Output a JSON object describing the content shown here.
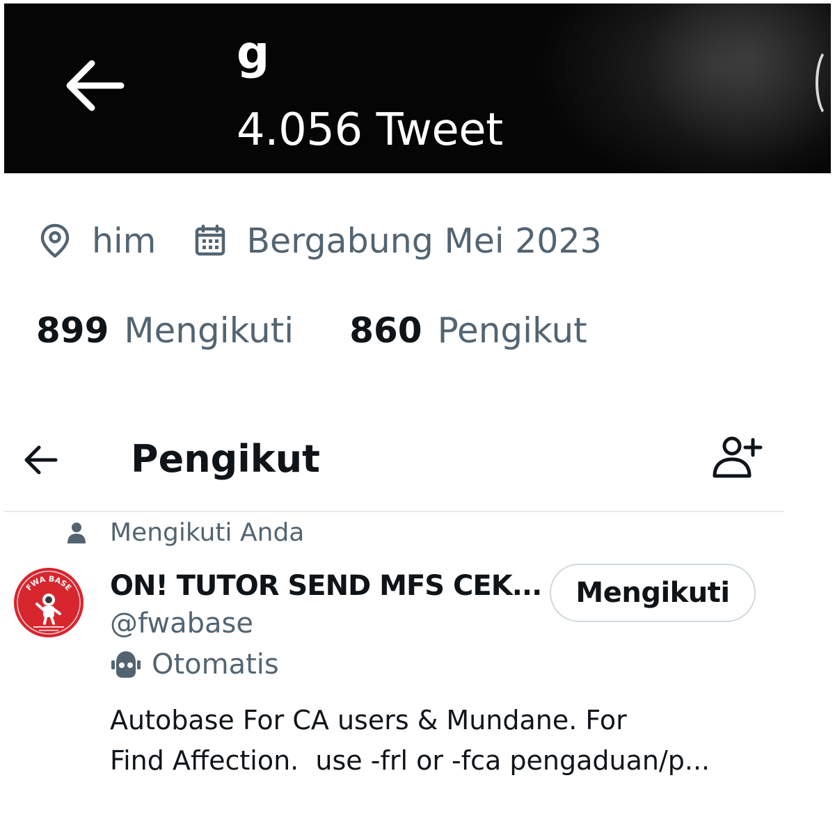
{
  "profile_header": {
    "name": "g",
    "tweet_count": "4.056 Tweet"
  },
  "profile_meta": {
    "location": "him",
    "joined": "Bergabung Mei 2023",
    "following_count": "899",
    "following_label": "Mengikuti",
    "followers_count": "860",
    "followers_label": "Pengikut"
  },
  "followers_page": {
    "title": "Pengikut"
  },
  "follower_entry": {
    "follows_you_label": "Mengikuti Anda",
    "display_name": "ON! TUTOR SEND MFS CEK...",
    "handle": "@fwabase",
    "automated_label": "Otomatis",
    "follow_button_label": "Mengikuti",
    "bio_lines": [
      "Autobase For CA users & Mundane. For",
      "Find Affection.  use -frl or -fca pengaduan/p..."
    ],
    "avatar_text": "FWA BASE"
  },
  "colors": {
    "header_bg": "#000000",
    "secondary_text": "#536471",
    "primary_text": "#0f1419",
    "avatar_red": "#d7262e",
    "divider": "#e6e9ec"
  },
  "icons": {
    "header_back": "arrow-left-icon",
    "location": "location-pin-icon",
    "calendar": "calendar-icon",
    "followers_back": "arrow-left-icon",
    "add_user": "add-user-icon",
    "follows_you": "person-icon",
    "automated": "robot-icon"
  }
}
